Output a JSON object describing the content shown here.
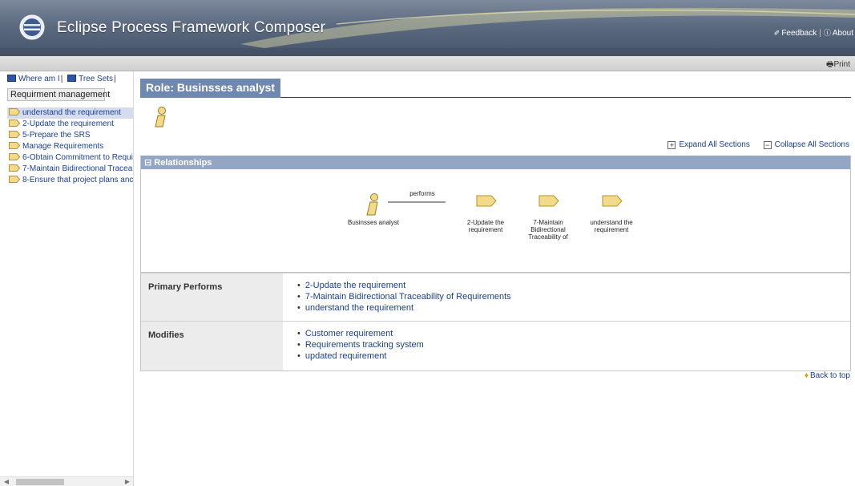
{
  "app": {
    "title": "Eclipse Process Framework Composer",
    "feedback_label": "Feedback",
    "about_label": "About",
    "print_label": "Print"
  },
  "left_pane": {
    "tabs": [
      "Where am I",
      "Tree Sets"
    ],
    "group_label": "Requirment management",
    "items": [
      {
        "label": "understand the requirement",
        "selected": true
      },
      {
        "label": "2-Update the requirement"
      },
      {
        "label": "5-Prepare the SRS"
      },
      {
        "label": "Manage Requirements"
      },
      {
        "label": "6-Obtain Commitment to Requi"
      },
      {
        "label": "7-Maintain Bidirectional Tracea"
      },
      {
        "label": "8-Ensure that project plans anc"
      }
    ]
  },
  "main": {
    "role_title": "Role: Businsses analyst",
    "expand_all_label": "Expand All Sections",
    "collapse_all_label": "Collapse All Sections",
    "relationships": {
      "header": "Relationships",
      "role_label": "Businsses analyst",
      "edge_label": "performs",
      "tasks": [
        [
          "2-Update the",
          "requirement"
        ],
        [
          "7-Maintain",
          "Bidirectional",
          "Traceability of"
        ],
        [
          "understand the",
          "requirement"
        ]
      ]
    },
    "table": {
      "primary_performs_label": "Primary Performs",
      "primary_performs": [
        "2-Update the requirement",
        "7-Maintain Bidirectional Traceability of Requirements",
        "understand the requirement"
      ],
      "modifies_label": "Modifies",
      "modifies": [
        "Customer requirement",
        "Requirements tracking system",
        "updated requirement"
      ]
    },
    "back_to_top_label": "Back to top"
  },
  "colors": {
    "role_title_bg": "#6f88b0",
    "section_header_bg": "#93a7c4",
    "link": "#1a3f93",
    "task_icon": "#f3d98a"
  }
}
